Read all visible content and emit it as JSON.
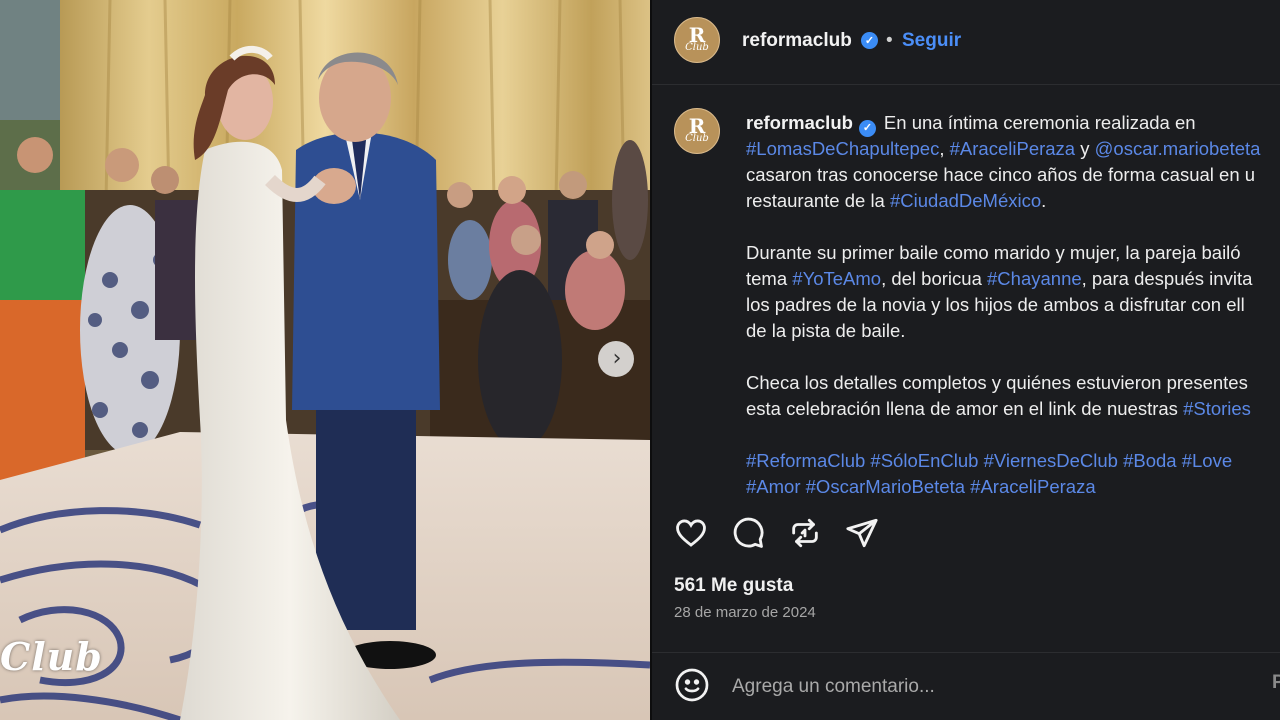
{
  "photo": {
    "watermark": "Club",
    "next_icon": "chevron-right-icon"
  },
  "account": {
    "avatar_letter": "R",
    "avatar_script": "Club",
    "username": "reformaclub",
    "verified_icon": "verified-badge-icon",
    "separator": "•",
    "follow_label": "Seguir"
  },
  "caption": {
    "username": "reformaclub",
    "lines": [
      [
        {
          "t": "En una íntima ceremonia realizada en",
          "tag": false
        }
      ],
      [
        {
          "t": "#LomasDeChapultepec",
          "tag": true
        },
        {
          "t": ", ",
          "tag": false
        },
        {
          "t": "#AraceliPeraza",
          "tag": true
        },
        {
          "t": " y ",
          "tag": false
        },
        {
          "t": "@oscar.mariobeteta",
          "tag": true
        }
      ],
      [
        {
          "t": "casaron tras conocerse hace cinco años de forma casual en u",
          "tag": false
        }
      ],
      [
        {
          "t": "restaurante de la ",
          "tag": false
        },
        {
          "t": "#CiudadDeMéxico",
          "tag": true
        },
        {
          "t": ".",
          "tag": false
        }
      ],
      [],
      [
        {
          "t": "Durante su primer baile como marido y mujer, la pareja bailó",
          "tag": false
        }
      ],
      [
        {
          "t": "tema ",
          "tag": false
        },
        {
          "t": "#YoTeAmo",
          "tag": true
        },
        {
          "t": ", del boricua ",
          "tag": false
        },
        {
          "t": "#Chayanne",
          "tag": true
        },
        {
          "t": ", para después invita",
          "tag": false
        }
      ],
      [
        {
          "t": "los padres de la novia y los hijos de ambos a disfrutar con ell",
          "tag": false
        }
      ],
      [
        {
          "t": "de la pista de baile.",
          "tag": false
        }
      ],
      [],
      [
        {
          "t": "Checa los detalles completos y quiénes estuvieron presentes",
          "tag": false
        }
      ],
      [
        {
          "t": "esta celebración llena de amor en el link de nuestras ",
          "tag": false
        },
        {
          "t": "#Stories",
          "tag": true
        }
      ],
      [],
      [
        {
          "t": "#ReformaClub",
          "tag": true
        },
        {
          "t": " ",
          "tag": false
        },
        {
          "t": "#SóloEnClub",
          "tag": true
        },
        {
          "t": " ",
          "tag": false
        },
        {
          "t": "#ViernesDeClub",
          "tag": true
        },
        {
          "t": " ",
          "tag": false
        },
        {
          "t": "#Boda",
          "tag": true
        },
        {
          "t": " ",
          "tag": false
        },
        {
          "t": "#Love",
          "tag": true
        }
      ],
      [
        {
          "t": "#Amor",
          "tag": true
        },
        {
          "t": " ",
          "tag": false
        },
        {
          "t": "#OscarMarioBeteta",
          "tag": true
        },
        {
          "t": " ",
          "tag": false
        },
        {
          "t": "#AraceliPeraza",
          "tag": true
        }
      ]
    ]
  },
  "actions": {
    "icons": [
      "heart-icon",
      "comment-icon",
      "repost-icon",
      "share-icon"
    ]
  },
  "likes": "561 Me gusta",
  "date": "28 de marzo de 2024",
  "comment": {
    "emoji_icon": "emoji-icon",
    "placeholder": "Agrega un comentario...",
    "post_label": "P"
  },
  "colors": {
    "panel_bg": "#1b1c1f",
    "hashtag": "#5b88e6",
    "follow": "#4b8ef7",
    "verified": "#3b8cf5"
  }
}
